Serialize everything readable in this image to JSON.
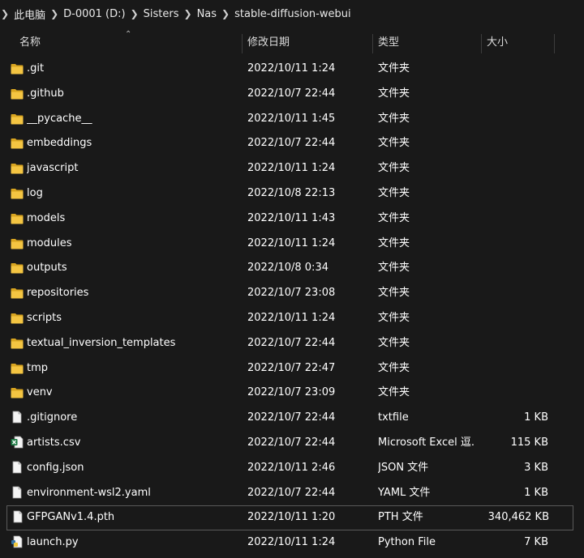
{
  "breadcrumb": [
    "此电脑",
    "D-0001 (D:)",
    "Sisters",
    "Nas",
    "stable-diffusion-webui"
  ],
  "columns": {
    "name": "名称",
    "date": "修改日期",
    "type": "类型",
    "size": "大小"
  },
  "files": [
    {
      "name": ".git",
      "date": "2022/10/11 1:24",
      "type": "文件夹",
      "size": "",
      "icon": "folder-icon"
    },
    {
      "name": ".github",
      "date": "2022/10/7 22:44",
      "type": "文件夹",
      "size": "",
      "icon": "folder-icon"
    },
    {
      "name": "__pycache__",
      "date": "2022/10/11 1:45",
      "type": "文件夹",
      "size": "",
      "icon": "folder-icon"
    },
    {
      "name": "embeddings",
      "date": "2022/10/7 22:44",
      "type": "文件夹",
      "size": "",
      "icon": "folder-icon"
    },
    {
      "name": "javascript",
      "date": "2022/10/11 1:24",
      "type": "文件夹",
      "size": "",
      "icon": "folder-icon"
    },
    {
      "name": "log",
      "date": "2022/10/8 22:13",
      "type": "文件夹",
      "size": "",
      "icon": "folder-icon"
    },
    {
      "name": "models",
      "date": "2022/10/11 1:43",
      "type": "文件夹",
      "size": "",
      "icon": "folder-icon"
    },
    {
      "name": "modules",
      "date": "2022/10/11 1:24",
      "type": "文件夹",
      "size": "",
      "icon": "folder-icon"
    },
    {
      "name": "outputs",
      "date": "2022/10/8 0:34",
      "type": "文件夹",
      "size": "",
      "icon": "folder-icon"
    },
    {
      "name": "repositories",
      "date": "2022/10/7 23:08",
      "type": "文件夹",
      "size": "",
      "icon": "folder-icon"
    },
    {
      "name": "scripts",
      "date": "2022/10/11 1:24",
      "type": "文件夹",
      "size": "",
      "icon": "folder-icon"
    },
    {
      "name": "textual_inversion_templates",
      "date": "2022/10/7 22:44",
      "type": "文件夹",
      "size": "",
      "icon": "folder-icon"
    },
    {
      "name": "tmp",
      "date": "2022/10/7 22:47",
      "type": "文件夹",
      "size": "",
      "icon": "folder-icon"
    },
    {
      "name": "venv",
      "date": "2022/10/7 23:09",
      "type": "文件夹",
      "size": "",
      "icon": "folder-icon"
    },
    {
      "name": ".gitignore",
      "date": "2022/10/7 22:44",
      "type": "txtfile",
      "size": "1 KB",
      "icon": "file-icon"
    },
    {
      "name": "artists.csv",
      "date": "2022/10/7 22:44",
      "type": "Microsoft Excel 逗...",
      "size": "115 KB",
      "icon": "excel-icon"
    },
    {
      "name": "config.json",
      "date": "2022/10/11 2:46",
      "type": "JSON 文件",
      "size": "3 KB",
      "icon": "file-icon"
    },
    {
      "name": "environment-wsl2.yaml",
      "date": "2022/10/7 22:44",
      "type": "YAML 文件",
      "size": "1 KB",
      "icon": "file-icon"
    },
    {
      "name": "GFPGANv1.4.pth",
      "date": "2022/10/11 1:20",
      "type": "PTH 文件",
      "size": "340,462 KB",
      "icon": "file-icon",
      "selected": true
    },
    {
      "name": "launch.py",
      "date": "2022/10/11 1:24",
      "type": "Python File",
      "size": "7 KB",
      "icon": "python-icon"
    }
  ],
  "colors": {
    "background": "#191919",
    "folder": "#f4c542",
    "folder_dark": "#d9a520"
  }
}
